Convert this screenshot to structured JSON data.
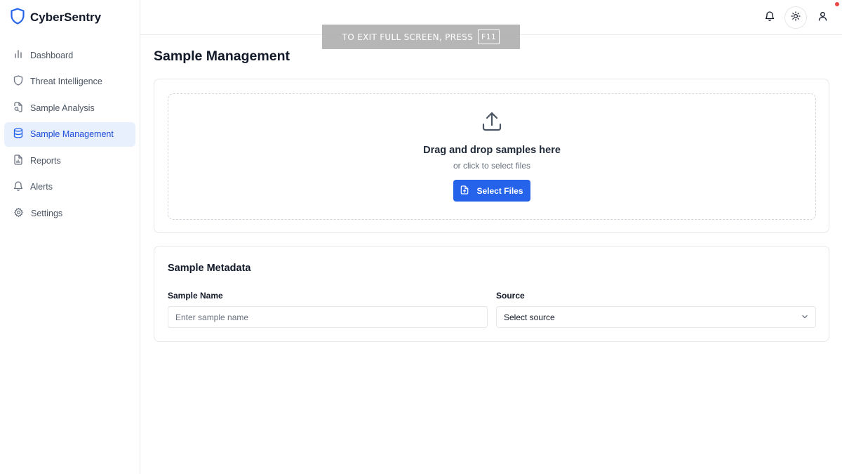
{
  "app": {
    "name": "CyberSentry"
  },
  "sidebar": {
    "items": [
      {
        "label": "Dashboard",
        "icon": "bar-chart-icon",
        "active": false
      },
      {
        "label": "Threat Intelligence",
        "icon": "shield-icon",
        "active": false
      },
      {
        "label": "Sample Analysis",
        "icon": "file-search-icon",
        "active": false
      },
      {
        "label": "Sample Management",
        "icon": "database-icon",
        "active": true
      },
      {
        "label": "Reports",
        "icon": "file-chart-icon",
        "active": false
      },
      {
        "label": "Alerts",
        "icon": "bell-icon",
        "active": false
      },
      {
        "label": "Settings",
        "icon": "gear-icon",
        "active": false
      }
    ]
  },
  "topbar": {
    "icons": [
      "bell-icon",
      "sun-icon",
      "user-icon"
    ]
  },
  "fullscreen_notice": {
    "text": "TO EXIT FULL SCREEN, PRESS",
    "key": "F11"
  },
  "page": {
    "title": "Sample Management"
  },
  "upload": {
    "title": "Drag and drop samples here",
    "subtitle": "or click to select files",
    "button_label": "Select Files"
  },
  "metadata": {
    "title": "Sample Metadata",
    "name_label": "Sample Name",
    "name_placeholder": "Enter sample name",
    "name_value": "",
    "source_label": "Source",
    "source_value": "Select source"
  },
  "colors": {
    "accent": "#2563eb",
    "active_nav_bg": "#e8effd",
    "active_nav_text": "#1d4ed8",
    "notification_dot": "#ef4444"
  }
}
